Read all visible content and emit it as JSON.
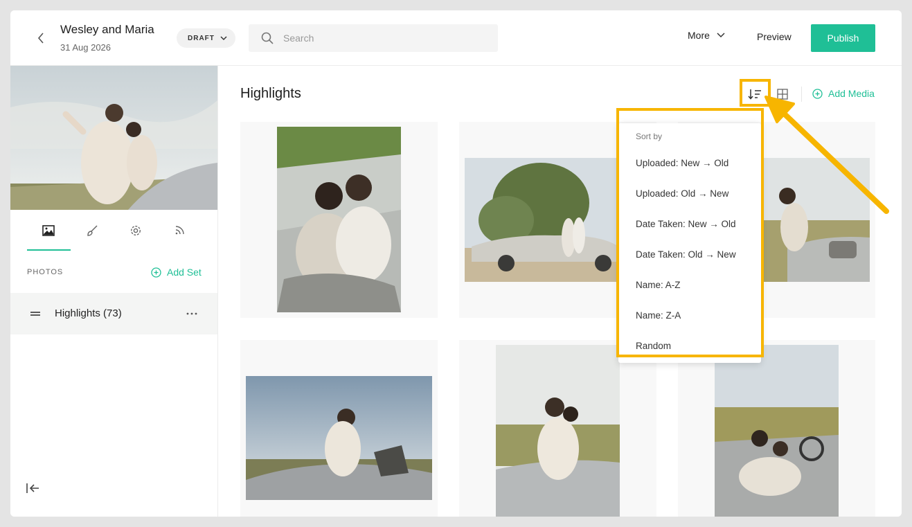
{
  "header": {
    "title": "Wesley and Maria",
    "date": "31 Aug 2026",
    "status_label": "DRAFT",
    "search_placeholder": "Search",
    "more_label": "More",
    "preview_label": "Preview",
    "publish_label": "Publish"
  },
  "sidebar": {
    "tabs": [
      "image-icon",
      "brush-icon",
      "gear-icon",
      "rss-icon"
    ],
    "section_label": "PHOTOS",
    "add_set_label": "Add Set",
    "sets": [
      {
        "label": "Highlights (73)"
      }
    ]
  },
  "main": {
    "title": "Highlights",
    "add_media_label": "Add Media"
  },
  "sort_menu": {
    "header": "Sort by",
    "options": [
      "Uploaded: New → Old",
      "Uploaded: Old → New",
      "Date Taken: New → Old",
      "Date Taken: Old → New",
      "Name: A-Z",
      "Name: Z-A",
      "Random"
    ]
  },
  "colors": {
    "accent": "#1fbf96",
    "highlight": "#f7b500"
  }
}
